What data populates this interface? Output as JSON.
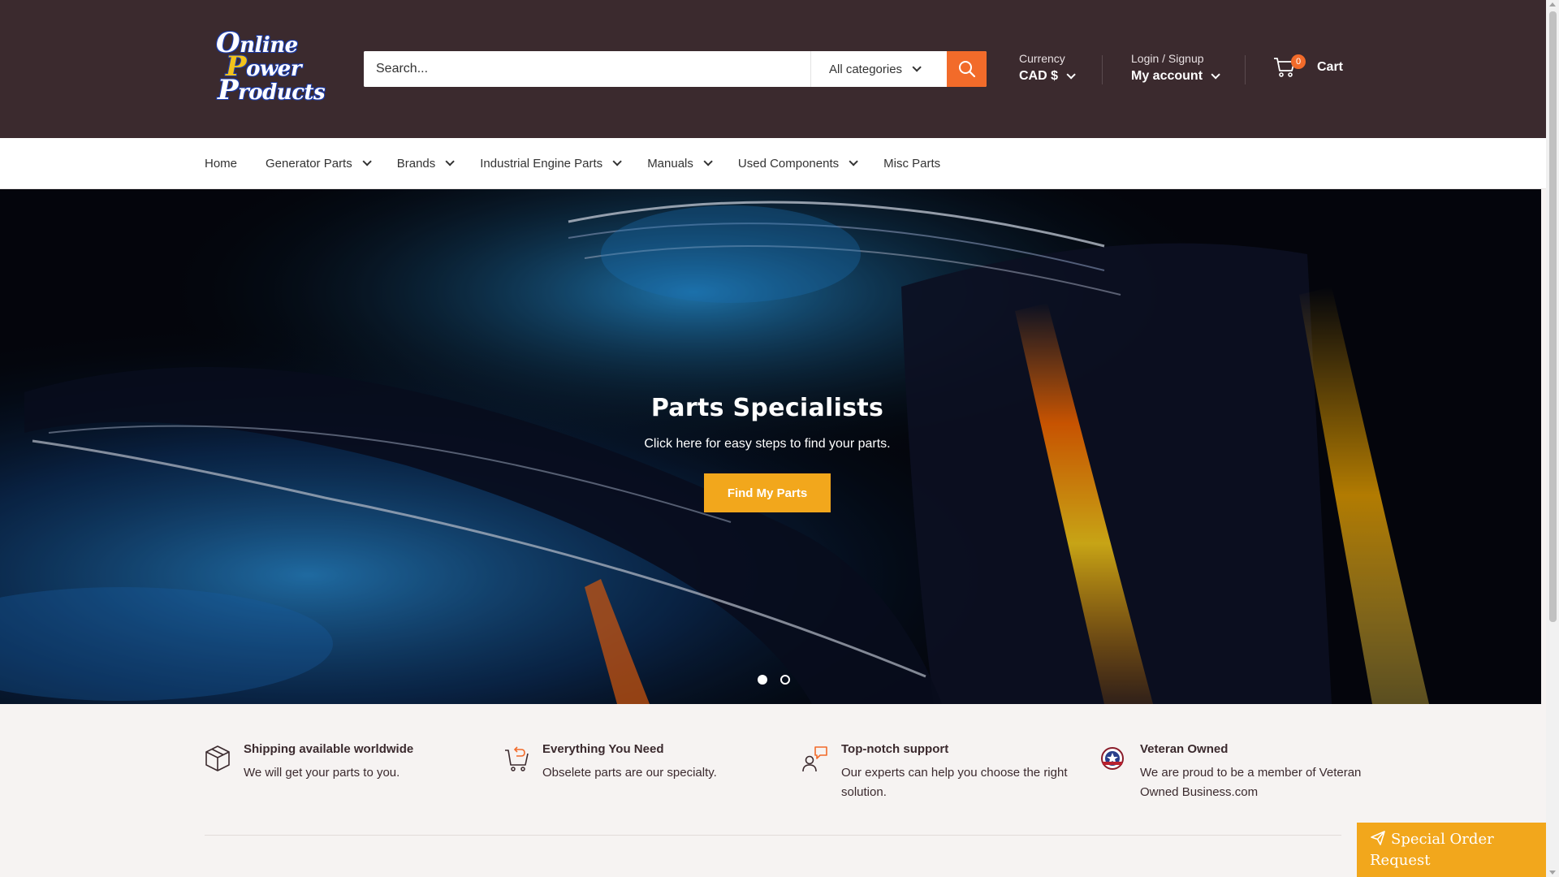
{
  "colors": {
    "header_bg": "#3b2a2e",
    "accent_orange": "#f26b2a",
    "accent_gold": "#f2a71c",
    "page_bg": "#f6f3f2"
  },
  "logo": {
    "alt": "Online Power Products",
    "line1_cap": "O",
    "line1_rest": "nline",
    "line2_cap": "P",
    "line2_rest": "ower",
    "line3_cap": "P",
    "line3_rest": "roducts"
  },
  "search": {
    "placeholder": "Search...",
    "category": "All categories",
    "submit_icon": "search-icon"
  },
  "currency": {
    "label": "Currency",
    "value": "CAD $"
  },
  "account": {
    "label": "Login / Signup",
    "value": "My account"
  },
  "cart": {
    "label": "Cart",
    "count": "0",
    "icon": "cart-icon"
  },
  "nav": {
    "items": [
      {
        "label": "Home",
        "dropdown": false
      },
      {
        "label": "Generator Parts",
        "dropdown": true
      },
      {
        "label": "Brands",
        "dropdown": true
      },
      {
        "label": "Industrial Engine Parts",
        "dropdown": true
      },
      {
        "label": "Manuals",
        "dropdown": true
      },
      {
        "label": "Used Components",
        "dropdown": true
      },
      {
        "label": "Misc Parts",
        "dropdown": false
      }
    ]
  },
  "hero": {
    "title": "Parts Specialists",
    "subtitle": "Click here for easy steps to find your parts.",
    "button": "Find My Parts",
    "slides": 2,
    "active_slide": 1
  },
  "features": [
    {
      "icon": "box-icon",
      "title": "Shipping available worldwide",
      "text": "We will get your parts to you."
    },
    {
      "icon": "cart-return-icon",
      "title": "Everything You Need",
      "text": "Obselete parts are our specialty."
    },
    {
      "icon": "support-icon",
      "title": "Top-notch support",
      "text": "Our experts can help you choose the right solution."
    },
    {
      "icon": "veteran-badge-icon",
      "title": "Veteran Owned",
      "text": "We are proud to be a member of Veteran Owned Business.com"
    }
  ],
  "special_order": {
    "label": "Special Order Request",
    "icon": "send-icon"
  }
}
